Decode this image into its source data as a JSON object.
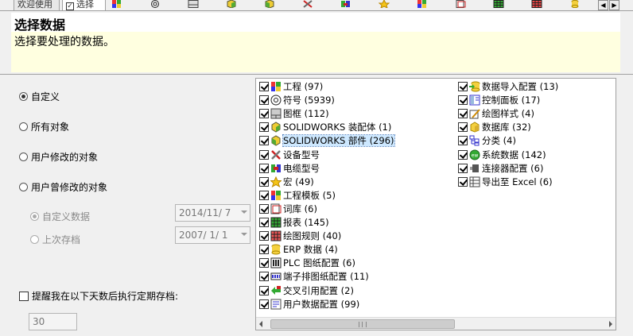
{
  "tabs": [
    {
      "label": "欢迎使用",
      "selected": false
    },
    {
      "label": "选择",
      "selected": true
    }
  ],
  "tab_icons": [
    "parts-icon",
    "symbol-icon",
    "frame-icon",
    "assembly-icon",
    "part-icon",
    "tools-icon",
    "cable-icon",
    "star-icon",
    "template-icon",
    "library-icon",
    "report-icon",
    "grid-icon",
    "database-icon"
  ],
  "header": {
    "title": "选择数据",
    "subtitle": "选择要处理的数据。"
  },
  "options": {
    "custom": "自定义",
    "all": "所有对象",
    "user_modified": "用户修改的对象",
    "user_ever_modified": "用户曾修改的对象",
    "custom_data": "自定义数据",
    "last_archive": "上次存档",
    "custom_date": "2014/11/ 7",
    "archive_date": "2007/ 1/ 1",
    "reminder": "提醒我在以下天数后执行定期存档:",
    "reminder_days": "30"
  },
  "list_left": [
    {
      "label": "工程 (97)",
      "icon": "project-icon"
    },
    {
      "label": "符号 (5939)",
      "icon": "symbol-icon"
    },
    {
      "label": "图框 (112)",
      "icon": "title-block-icon"
    },
    {
      "label": "SOLIDWORKS 装配体 (1)",
      "icon": "assembly-icon"
    },
    {
      "label": "SOLIDWORKS 部件 (296)",
      "icon": "part-icon",
      "highlight": true
    },
    {
      "label": "设备型号",
      "icon": "tools-icon"
    },
    {
      "label": "电缆型号",
      "icon": "cable-icon"
    },
    {
      "label": "宏 (49)",
      "icon": "star-icon"
    },
    {
      "label": "工程模板 (5)",
      "icon": "project-template-icon"
    },
    {
      "label": "词库 (6)",
      "icon": "dictionary-icon"
    },
    {
      "label": "报表 (145)",
      "icon": "report-icon"
    },
    {
      "label": "绘图规则 (40)",
      "icon": "drawing-rules-icon"
    },
    {
      "label": "ERP 数据 (4)",
      "icon": "erp-data-icon"
    },
    {
      "label": "PLC 图纸配置 (6)",
      "icon": "plc-icon"
    },
    {
      "label": "端子排图纸配置 (11)",
      "icon": "terminal-icon"
    },
    {
      "label": "交叉引用配置 (2)",
      "icon": "cross-ref-icon"
    },
    {
      "label": "用户数据配置 (99)",
      "icon": "user-data-icon"
    }
  ],
  "list_right": [
    {
      "label": "数据导入配置 (13)",
      "icon": "import-icon"
    },
    {
      "label": "控制面板 (17)",
      "icon": "control-panel-icon"
    },
    {
      "label": "绘图样式 (4)",
      "icon": "drawing-style-icon"
    },
    {
      "label": "数据库 (32)",
      "icon": "database-icon"
    },
    {
      "label": "分类 (4)",
      "icon": "classification-icon"
    },
    {
      "label": "系统数据 (142)",
      "icon": "system-data-icon"
    },
    {
      "label": "连接器配置 (6)",
      "icon": "connector-icon"
    },
    {
      "label": "导出至 Excel (6)",
      "icon": "excel-icon"
    }
  ],
  "colors": {
    "header_bg": "#ffffe0",
    "highlight": "#cde8ff",
    "disabled_text": "#8a8a8a"
  }
}
